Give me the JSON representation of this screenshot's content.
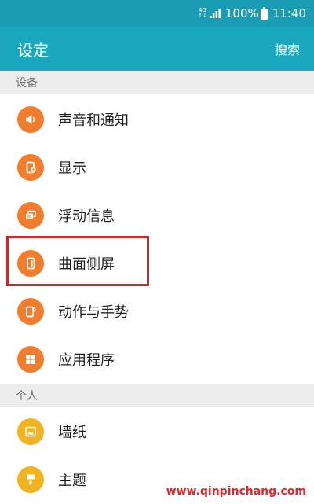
{
  "status_bar": {
    "network_top": "4G",
    "network_bottom": "↑↓",
    "battery_percent": "100%",
    "time": "11:40"
  },
  "app_bar": {
    "title": "设定",
    "search_label": "搜索"
  },
  "sections": [
    {
      "header": "设备",
      "items": [
        {
          "label": "声音和通知",
          "icon": "speaker-icon"
        },
        {
          "label": "显示",
          "icon": "display-icon"
        },
        {
          "label": "浮动信息",
          "icon": "floating-messages-icon"
        },
        {
          "label": "曲面侧屏",
          "icon": "edge-screen-icon"
        },
        {
          "label": "动作与手势",
          "icon": "motions-gestures-icon"
        },
        {
          "label": "应用程序",
          "icon": "apps-grid-icon"
        }
      ]
    },
    {
      "header": "个人",
      "items": [
        {
          "label": "墙纸",
          "icon": "wallpaper-icon"
        },
        {
          "label": "主题",
          "icon": "themes-brush-icon"
        }
      ]
    }
  ],
  "colors": {
    "status_bar": "#1a9db4",
    "app_bar": "#1aa8bf",
    "icon_orange": "#ef7d2d",
    "icon_yellow": "#f2b322",
    "highlight": "#cc2a2a",
    "watermark": "#e0272b"
  },
  "highlighted_item": "曲面侧屏",
  "watermark": "www.qinpinchang.com"
}
